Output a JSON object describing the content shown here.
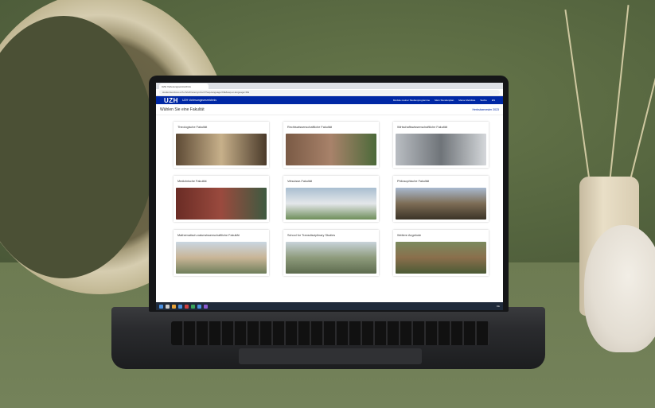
{
  "browser": {
    "tab_title": "UZH Vorlesungsverzeichnis",
    "url": "studentservices.uzh.ch/uzh/anonym/vvz/?sap-language=DE&sap-ui-language=DE"
  },
  "site": {
    "logo": "UZH",
    "title": "UZH Vorlesungsverzeichnis",
    "nav": [
      "Module meiner Studienprogramme",
      "Mein Stundenplan",
      "Meine Merkliste",
      "Suche",
      "EN"
    ]
  },
  "page": {
    "heading": "Wählen Sie eine Fakultät",
    "semester": "Herbstsemester 2023"
  },
  "faculties": [
    {
      "label": "Theologische Fakultät",
      "color": "#9b8a6a"
    },
    {
      "label": "Rechtswissenschaftliche Fakultät",
      "color": "#8a6a55"
    },
    {
      "label": "Wirtschaftswissenschaftliche Fakultät",
      "color": "#8c8f93"
    },
    {
      "label": "Medizinische Fakultät",
      "color": "#7a3a32"
    },
    {
      "label": "Vetsuisse-Fakultät",
      "color": "#9fb0bf"
    },
    {
      "label": "Philosophische Fakultät",
      "color": "#8e8470"
    },
    {
      "label": "Mathematisch-naturwissenschaftliche Fakultät",
      "color": "#b9a58a"
    },
    {
      "label": "School for Transdisciplinary Studies",
      "color": "#7f8f70"
    },
    {
      "label": "Weitere Angebote",
      "color": "#6d6a4f"
    }
  ],
  "taskbar": {
    "clock": "DE"
  }
}
